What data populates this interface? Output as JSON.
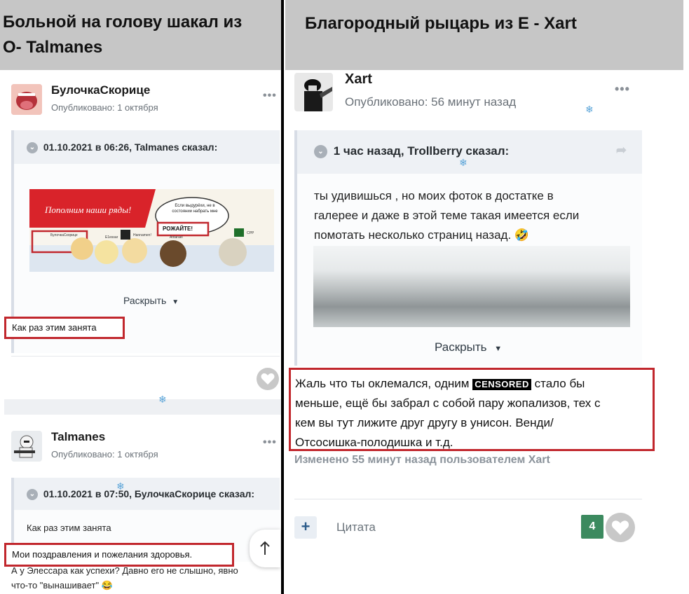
{
  "headers": {
    "left_line1": "Больной на голову шакал из",
    "left_line2": "O- Talmanes",
    "right": "Благородный рыцарь из E - Xart"
  },
  "left": {
    "post1": {
      "author": "БулочкаСкорице",
      "published": "Опубликовано: 1 октября",
      "quote_header": "01.10.2021 в 06:26, Talmanes сказал:",
      "banner_text": "Пополним наши ряды!",
      "bubble_text": "Если выдурёхи, не в состоянии набрать мне",
      "bubble_cta": "РОЖАЙТЕ!",
      "banner_names": [
        "БулочкаСкорице",
        "E1essar",
        "Hannamen!",
        "Antarael",
        "CPP"
      ],
      "expand": "Раскрыть",
      "reply": "Как раз этим занята"
    },
    "post2": {
      "author": "Talmanes",
      "published": "Опубликовано: 1 октября",
      "quote_header": "01.10.2021 в 07:50, БулочкаСкорице сказал:",
      "quote_text": "Как раз этим занята",
      "reply": "Мои поздравления и пожелания здоровья.",
      "extra_line1": "А у Элессара как успехи? Давно его не слышно, явно",
      "extra_line2": "что-то \"вынашивает\" 😂"
    },
    "scroll_top_icon": "arrow-up-icon"
  },
  "right": {
    "post": {
      "author": "Xart",
      "published": "Опубликовано: 56 минут назад",
      "quote_header": "1 час назад, Trollberry сказал:",
      "quote_line1": "ты удивишься , но моих фоток в достатке в",
      "quote_line2": "галерее и даже в этой теме такая имеется если",
      "quote_line3": "помотать несколько страниц назад. 🤣",
      "expand": "Раскрыть",
      "reply_part1": "Жаль что ты оклемался, одним",
      "censored": "CENSORED",
      "reply_part2": "стало бы",
      "reply_line2": "меньше, ещё бы забрал с собой пару жопализов, тех с",
      "reply_line3": "кем вы тут лижите друг другу в унисон. Венди/",
      "reply_line4": "Отсосишка-полодишка и т.д.",
      "edited": "Изменено 55 минут назад пользователем Xart",
      "quote_button": "Цитата",
      "add_button": "+",
      "reaction_count": "4"
    }
  },
  "colors": {
    "header_bg": "#c6c6c6",
    "red_outline": "#c1272d",
    "reaction_green": "#3c8a5f",
    "heart_gray": "#c8c8c8"
  }
}
